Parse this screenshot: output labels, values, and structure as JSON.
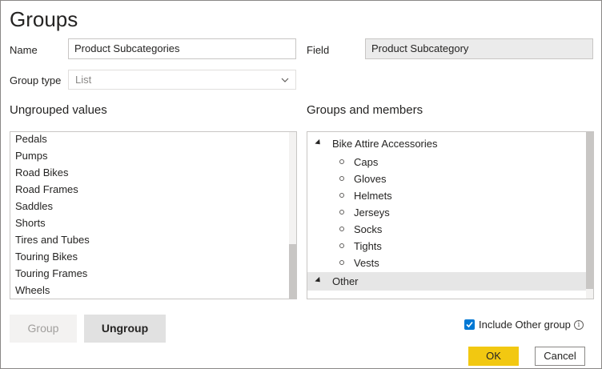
{
  "dialog": {
    "title": "Groups"
  },
  "form": {
    "name_label": "Name",
    "name_value": "Product Subcategories",
    "field_label": "Field",
    "field_value": "Product Subcategory",
    "group_type_label": "Group type",
    "group_type_value": "List"
  },
  "ungrouped": {
    "header": "Ungrouped values",
    "items": [
      "Pedals",
      "Pumps",
      "Road Bikes",
      "Road Frames",
      "Saddles",
      "Shorts",
      "Tires and Tubes",
      "Touring Bikes",
      "Touring Frames",
      "Wheels"
    ]
  },
  "groups": {
    "header": "Groups and members",
    "group1_name": "Bike Attire Accessories",
    "group1_members": [
      "Caps",
      "Gloves",
      "Helmets",
      "Jerseys",
      "Socks",
      "Tights",
      "Vests"
    ],
    "group2_name": "Other"
  },
  "buttons": {
    "group": "Group",
    "ungroup": "Ungroup",
    "ok": "OK",
    "cancel": "Cancel"
  },
  "options": {
    "include_other_label": "Include Other group",
    "include_other_checked": true
  },
  "icons": {
    "dropdown": "chevron-down-icon",
    "info": "info-icon",
    "expand": "caret-expanded-icon",
    "check": "checkmark-icon"
  },
  "colors": {
    "ok_button": "#f2c811",
    "checkbox": "#0078d4",
    "selected_row": "#e6e6e6"
  }
}
